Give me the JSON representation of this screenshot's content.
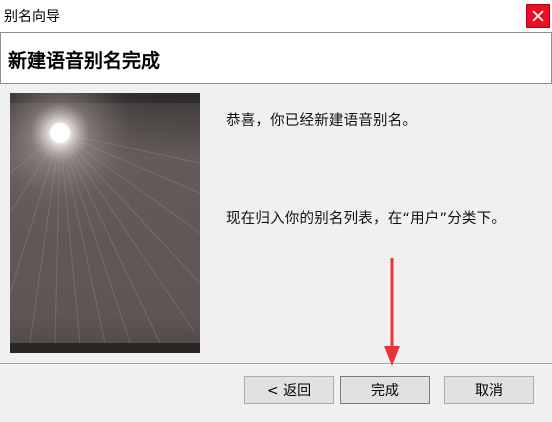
{
  "window": {
    "title": "别名向导",
    "close_icon": "close-icon"
  },
  "header": {
    "title": "新建语音别名完成"
  },
  "main": {
    "message_1": "恭喜，你已经新建语音别名。",
    "message_2": "现在归入你的别名列表，在“用户”分类下。"
  },
  "buttons": {
    "back": "< 返回",
    "finish": "完成",
    "cancel": "取消"
  },
  "annotation": {
    "arrow_color": "#e8323c",
    "points_to": "finish-button"
  },
  "colors": {
    "close_button": "#e81123",
    "header_bg": "#ffffff",
    "dialog_bg": "#f0f0f0"
  }
}
